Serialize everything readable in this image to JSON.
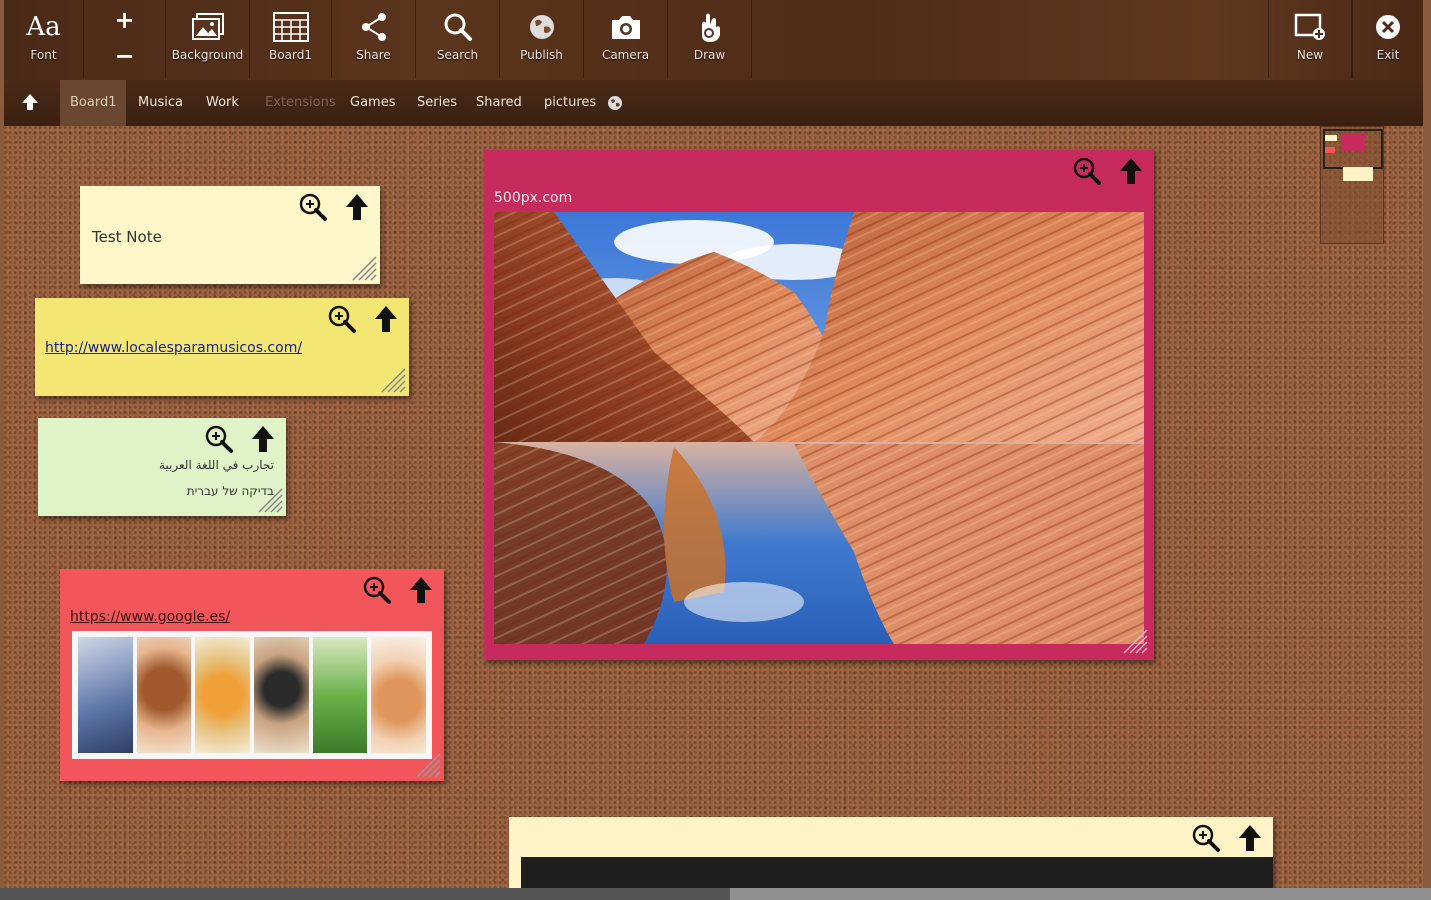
{
  "toolbar": {
    "font_label": "Font",
    "font_glyph": "Aa",
    "plus": "+",
    "minus": "−",
    "background_label": "Background",
    "board_label": "Board1",
    "share_label": "Share",
    "search_label": "Search",
    "publish_label": "Publish",
    "camera_label": "Camera",
    "draw_label": "Draw",
    "new_label": "New",
    "exit_label": "Exit"
  },
  "tabs": [
    {
      "label": "Board1",
      "state": "active"
    },
    {
      "label": "Musica"
    },
    {
      "label": "Work"
    },
    {
      "label": "Extensions",
      "state": "dim"
    },
    {
      "label": "Games"
    },
    {
      "label": "Series"
    },
    {
      "label": "Shared"
    },
    {
      "label": "pictures"
    }
  ],
  "notes": {
    "test_note": {
      "text": "Test Note",
      "color": "#fdf6c9"
    },
    "link_note": {
      "link": "http://www.localesparamusicos.com/",
      "color": "#f3e672"
    },
    "rtl_note": {
      "line1": "تجارب في اللغة العربية",
      "line2": "בדיקה של עברית",
      "color": "#dff2c8"
    },
    "google_note": {
      "link": "https://www.google.es/",
      "color": "#f2555a"
    },
    "photo_note": {
      "source": "500px.com",
      "color": "#c72b5e"
    },
    "bottom_note": {
      "color": "#fdf3c6"
    }
  },
  "colors": {
    "toolbar": "#4e2c18",
    "cork": "#9a6240"
  }
}
